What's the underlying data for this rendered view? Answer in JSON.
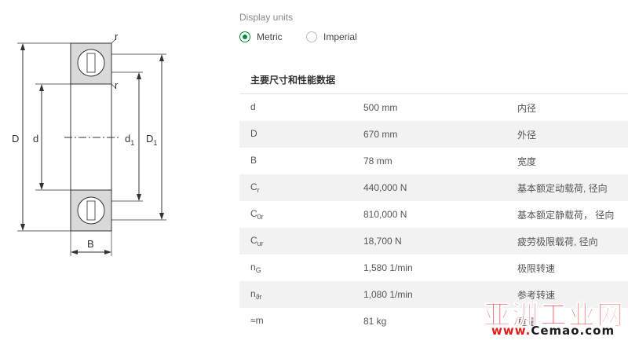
{
  "display_units": {
    "label": "Display units",
    "options": [
      {
        "label": "Metric",
        "selected": true
      },
      {
        "label": "Imperial",
        "selected": false
      }
    ]
  },
  "section_title": "主要尺寸和性能数据",
  "drawing_labels": {
    "D": "D",
    "d": "d",
    "d1_main": "d",
    "d1_sub": "1",
    "D1_main": "D",
    "D1_sub": "1",
    "B": "B",
    "r_top": "r",
    "r_mid": "r"
  },
  "rows": [
    {
      "sym": "d",
      "sub": "",
      "value": "500 mm",
      "desc": "内径"
    },
    {
      "sym": "D",
      "sub": "",
      "value": "670 mm",
      "desc": "外径"
    },
    {
      "sym": "B",
      "sub": "",
      "value": "78 mm",
      "desc": "宽度"
    },
    {
      "sym": "C",
      "sub": "r",
      "value": "440,000 N",
      "desc": "基本额定动载荷, 径向"
    },
    {
      "sym": "C",
      "sub": "0r",
      "value": "810,000 N",
      "desc": "基本额定静载荷， 径向"
    },
    {
      "sym": "C",
      "sub": "ur",
      "value": "18,700 N",
      "desc": "疲劳极限载荷, 径向"
    },
    {
      "sym": "n",
      "sub": "G",
      "value": "1,580 1/min",
      "desc": "极限转速"
    },
    {
      "sym": "n",
      "sub": "ϑr",
      "value": "1,080 1/min",
      "desc": "参考转速"
    },
    {
      "sym": "≈m",
      "sub": "",
      "value": "81 kg",
      "desc": "重量"
    }
  ],
  "watermark": {
    "cn": "亚洲工业网",
    "url_prefix": "www.",
    "url_main": "Cemao.com"
  },
  "colors": {
    "accent": "#00893d",
    "row_alt": "#f2f2f2",
    "watermark_red": "#e0201b"
  }
}
